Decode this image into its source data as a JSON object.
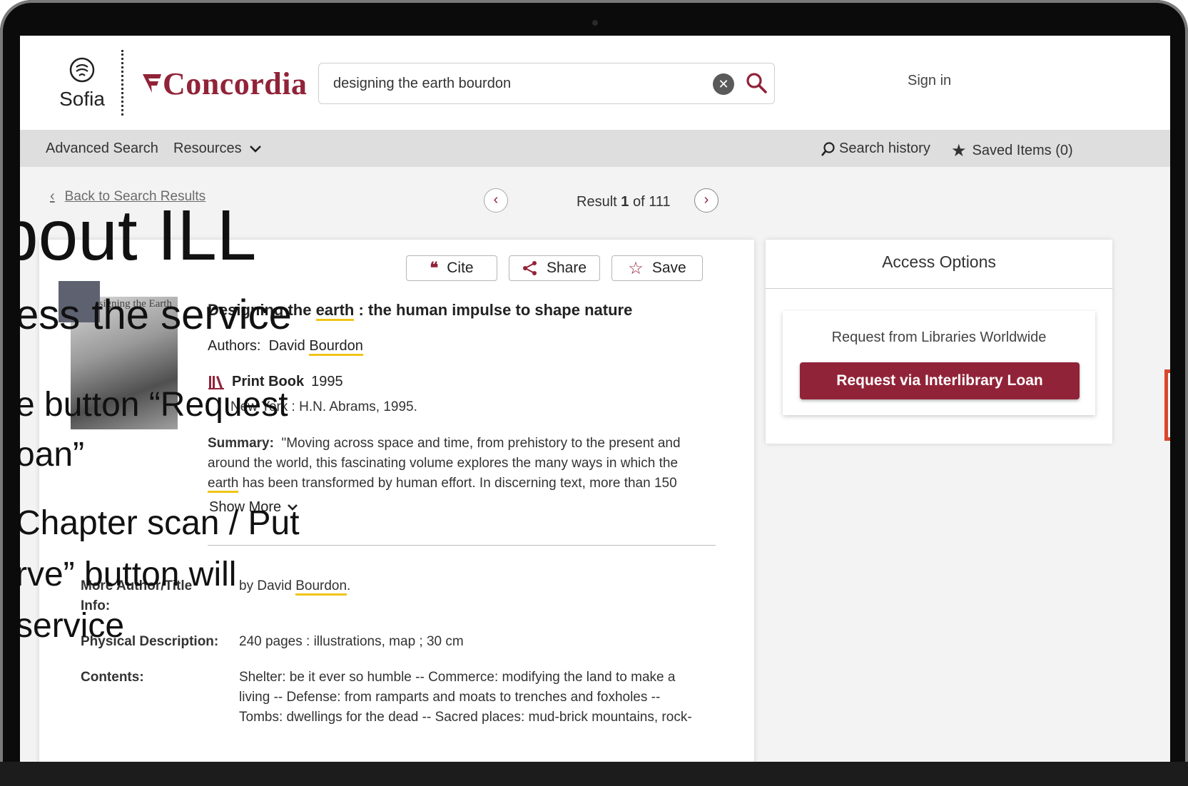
{
  "app": {
    "sofia_label": "Sofia",
    "brand": "Concordia",
    "sign_in": "Sign in"
  },
  "search": {
    "value": "designing the earth bourdon"
  },
  "nav": {
    "advanced_search": "Advanced Search",
    "resources": "Resources",
    "search_history": "Search history",
    "saved_items": "Saved Items (0)"
  },
  "crumbs": {
    "back": "Back to Search Results",
    "result_prefix": "Result",
    "result_index": "1",
    "result_suffix": "of 111"
  },
  "actions": {
    "cite": "Cite",
    "share": "Share",
    "save": "Save"
  },
  "record": {
    "cover_title": "Designing the Earth",
    "title_part1": "Designing the ",
    "title_hl": "earth",
    "title_part2": " : the human impulse to shape nature",
    "authors_label": "Authors:",
    "author_first": "David ",
    "author_last": "Bourdon",
    "format": "Print Book",
    "year": "1995",
    "publication": "New York : H.N. Abrams, 1995.",
    "summary_label": "Summary:",
    "summary_line1": "\"Moving across space and time, from prehistory to the present and",
    "summary_line2": "around the world, this fascinating volume explores the many ways in which the",
    "summary_hl": "earth",
    "summary_line3": " has been transformed by human effort. In discerning text, more than 150",
    "show_more": "Show More"
  },
  "details": {
    "more_info_label_1": "More Author/Title",
    "more_info_label_2": "Info:",
    "more_info_value_pre": "by David ",
    "more_info_value_hl": "Bourdon",
    "more_info_value_post": ".",
    "physical_label": "Physical Description:",
    "physical_value": "240 pages : illustrations, map ; 30 cm",
    "contents_label": "Contents:",
    "contents_line1": "Shelter: be it ever so humble -- Commerce: modifying the land to make a",
    "contents_line2": "living -- Defense: from ramparts and moats to trenches and foxholes --",
    "contents_line3": "Tombs: dwellings for the dead -- Sacred places: mud-brick mountains, rock-"
  },
  "access": {
    "title": "Access Options",
    "subtitle": "Request from Libraries Worldwide",
    "button": "Request via Interlibrary Loan"
  },
  "overlay": {
    "line1": "bout ILL",
    "line2": "ess the service",
    "line3": "e button “Request",
    "line4": "oan”",
    "line5": "Chapter scan / Put",
    "line6": "rve” button will",
    "line7": "service"
  },
  "colors": {
    "brand": "#912338",
    "highlight": "#f0c419",
    "nav_bg": "#dedede"
  },
  "icons": {
    "clear": "close-circle-icon",
    "search": "search-icon",
    "history": "search-history-icon",
    "star": "star-icon"
  }
}
